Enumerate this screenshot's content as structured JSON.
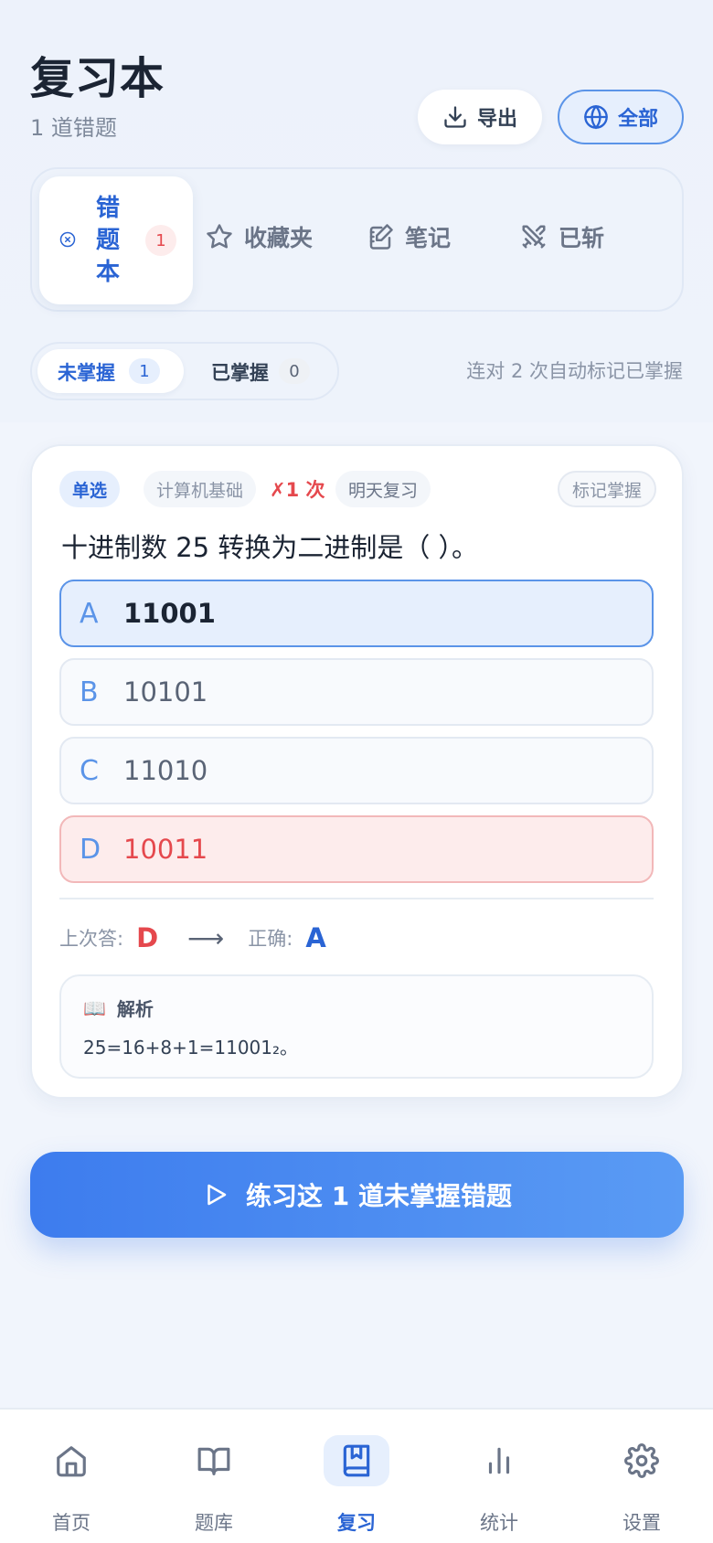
{
  "header": {
    "title": "复习本",
    "subtitle": "1 道错题",
    "export_label": "导出",
    "filter_label": "全部"
  },
  "tabs": {
    "active": {
      "label": "错题本",
      "chars": [
        "错",
        "题",
        "本"
      ],
      "count": "1"
    },
    "items": [
      {
        "label": "收藏夹",
        "icon": "star-icon"
      },
      {
        "label": "笔记",
        "icon": "note-icon"
      },
      {
        "label": "已斩",
        "icon": "swords-icon"
      }
    ]
  },
  "segment": {
    "unmastered_label": "未掌握",
    "unmastered_count": "1",
    "mastered_label": "已掌握",
    "mastered_count": "0",
    "hint": "连对 2 次自动标记已掌握"
  },
  "question": {
    "type": "单选",
    "subject": "计算机基础",
    "wrong_times": "✗1 次",
    "review": "明天复习",
    "mark_label": "标记掌握",
    "text": "十进制数 25 转换为二进制是（ ）。",
    "options": [
      {
        "letter": "A",
        "text": "11001",
        "state": "correct"
      },
      {
        "letter": "B",
        "text": "10101",
        "state": "normal"
      },
      {
        "letter": "C",
        "text": "11010",
        "state": "normal"
      },
      {
        "letter": "D",
        "text": "10011",
        "state": "wrong"
      }
    ],
    "last_answer_label": "上次答:",
    "last_answer": "D",
    "correct_label": "正确:",
    "correct_answer": "A",
    "explanation_title": "解析",
    "explanation_icon": "📖",
    "explanation": "25=16+8+1=11001₂。"
  },
  "practice_button": "练习这 1 道未掌握错题",
  "nav": [
    {
      "label": "首页",
      "icon": "home-icon",
      "active": false
    },
    {
      "label": "题库",
      "icon": "book-open-icon",
      "active": false
    },
    {
      "label": "复习",
      "icon": "bookmark-book-icon",
      "active": true
    },
    {
      "label": "统计",
      "icon": "bar-chart-icon",
      "active": false
    },
    {
      "label": "设置",
      "icon": "gear-icon",
      "active": false
    }
  ],
  "colors": {
    "accent": "#2a64d4",
    "danger": "#e5484d",
    "bg": "#f1f5fc"
  }
}
